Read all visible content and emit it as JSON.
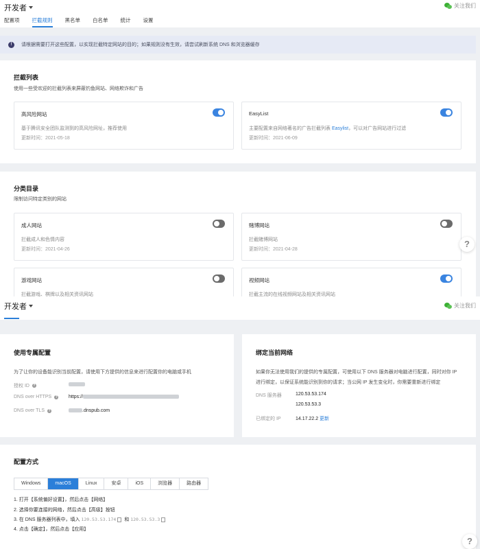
{
  "screen1": {
    "brand": "开发者",
    "follow": "关注我们",
    "tabs": [
      {
        "label": "配置项",
        "active": false
      },
      {
        "label": "拦截规则",
        "active": true
      },
      {
        "label": "黑名单",
        "active": false
      },
      {
        "label": "白名单",
        "active": false
      },
      {
        "label": "统计",
        "active": false
      },
      {
        "label": "设置",
        "active": false
      }
    ],
    "notice": "请根据需要打开这些配置，以实现拦截特定网站的目的；如果规则没有生效，请尝试刷新系统 DNS 和浏览器缓存",
    "blocklist": {
      "title": "拦截列表",
      "desc": "使用一些受欢迎的拦截列表来屏蔽钓鱼网站、网络欺诈和广告",
      "cards": [
        {
          "name": "高风险网站",
          "desc": "基于腾讯安全团队监测到的高风险网址，推荐使用",
          "date": "更新时间：2021-05-18",
          "on": true
        },
        {
          "name": "EasyList",
          "desc_pre": "主要配置来自网络著名的广告拦截列表 ",
          "desc_link": "Easylist",
          "desc_post": "，可以对广告网站进行过滤",
          "date": "更新时间：2021-06-09",
          "on": true
        }
      ]
    },
    "category": {
      "title": "分类目录",
      "desc": "限制访问特定类别的网站",
      "cards": [
        {
          "name": "成人网站",
          "desc": "拦截成人和色情内容",
          "date": "更新时间：2021-04-26",
          "on": false
        },
        {
          "name": "赌博网站",
          "desc": "拦截赌博网站",
          "date": "更新时间：2021-04-28",
          "on": false
        },
        {
          "name": "游戏网站",
          "desc": "拦截游戏、棋牌以及相关资讯网站",
          "on": false
        },
        {
          "name": "视频网站",
          "desc": "拦截主流的在线视频网站及相关资讯网站",
          "on": true
        }
      ]
    },
    "help": "?"
  },
  "screen2": {
    "brand": "开发者",
    "follow": "关注我们",
    "dedicated": {
      "title": "使用专属配置",
      "desc": "为了让你的设备能识别当前配置，请使用下方提供的信息来进行配置你的电脑或手机",
      "rows": [
        {
          "label": "授权 ID",
          "value": ""
        },
        {
          "label": "DNS over HTTPS",
          "value": "https://"
        },
        {
          "label": "DNS over TLS",
          "value": ".dnspub.com"
        }
      ]
    },
    "bind": {
      "title": "绑定当前网络",
      "desc1": "如果你无法使用我们的提供的专属配置，可使用以下 DNS 服务器对电脑进行配置，同时对你 IP",
      "desc2": "进行绑定，以保证系统能识别到你的请求；当公网 IP 发生变化时，你需要重新进行绑定",
      "dns_label": "DNS 服务器",
      "dns1": "120.53.53.174",
      "dns2": "120.53.53.3",
      "ip_label": "已绑定的 IP",
      "ip": "14.17.22.2",
      "refresh": "更新"
    },
    "config": {
      "title": "配置方式",
      "os_tabs": [
        {
          "label": "Windows",
          "active": false
        },
        {
          "label": "macOS",
          "active": true
        },
        {
          "label": "Linux",
          "active": false
        },
        {
          "label": "安卓",
          "active": false
        },
        {
          "label": "iOS",
          "active": false
        },
        {
          "label": "浏览器",
          "active": false
        },
        {
          "label": "路由器",
          "active": false
        }
      ],
      "step1": "1. 打开【系统偏好设置】，然后点击【网络】",
      "step2": "2. 选择你要连接的网络，然后点击【高级】按钮",
      "step3_pre": "3. 在 DNS 服务器列表中，填入",
      "step3_ip1": "120.53.53.174",
      "step3_mid": "和",
      "step3_ip2": "120.53.53.3",
      "step4": "4. 点击【确定】，然后点击【应用】"
    },
    "help": "?"
  },
  "colors": {
    "accent": "#2b7fd9",
    "toggle_on": "#3a84e0",
    "toggle_off": "#6b6b6b",
    "page_bg": "#eef0f3",
    "notice_bg": "#e6eaf5"
  }
}
